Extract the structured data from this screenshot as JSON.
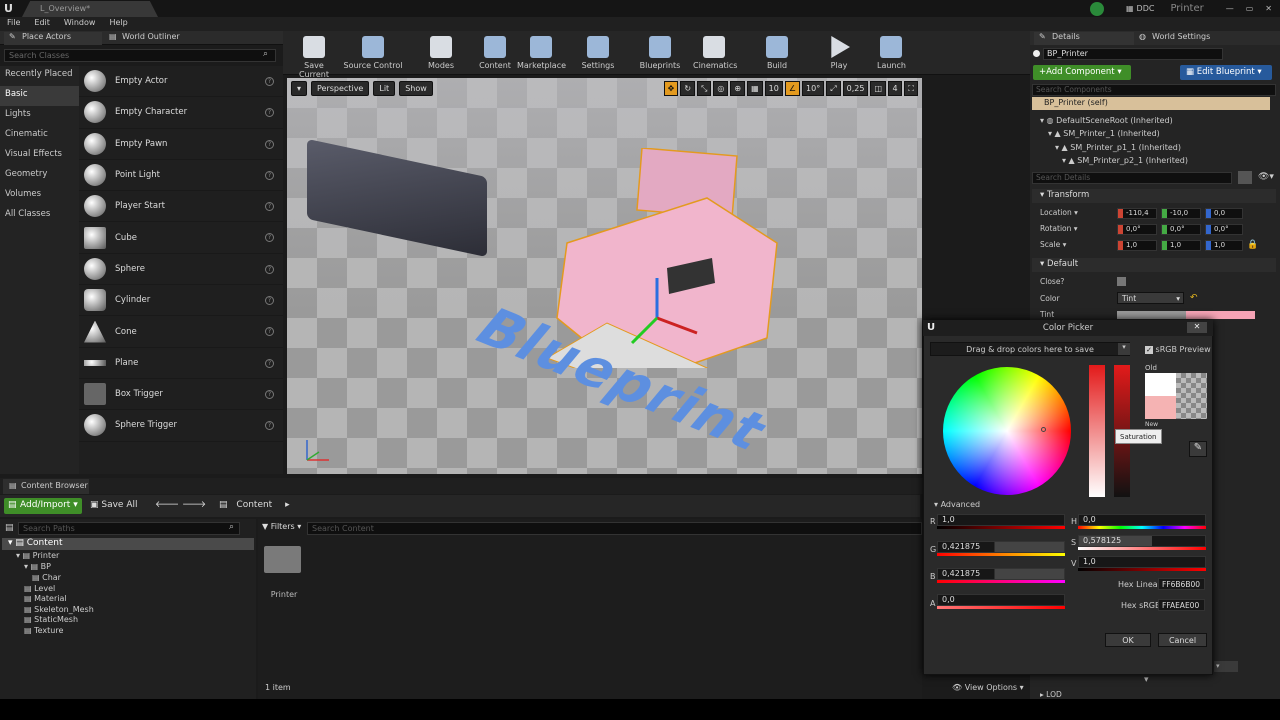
{
  "window": {
    "tab_title": "L_Overview*",
    "ddc": "DDC",
    "project": "Printer"
  },
  "menu": [
    "File",
    "Edit",
    "Window",
    "Help"
  ],
  "left_panel": {
    "tabs": {
      "place": "Place Actors",
      "outliner": "World Outliner"
    },
    "search_placeholder": "Search Classes",
    "categories": [
      "Recently Placed",
      "Basic",
      "Lights",
      "Cinematic",
      "Visual Effects",
      "Geometry",
      "Volumes",
      "All Classes"
    ],
    "actors": [
      "Empty Actor",
      "Empty Character",
      "Empty Pawn",
      "Point Light",
      "Player Start",
      "Cube",
      "Sphere",
      "Cylinder",
      "Cone",
      "Plane",
      "Box Trigger",
      "Sphere Trigger"
    ]
  },
  "toolbar": {
    "buttons": [
      "Save Current",
      "Source Control",
      "Modes",
      "Content",
      "Marketplace",
      "Settings",
      "Blueprints",
      "Cinematics",
      "Build",
      "Play",
      "Launch"
    ]
  },
  "viewport": {
    "perspective": "Perspective",
    "lit": "Lit",
    "show": "Show",
    "grid": "10",
    "angle": "10°",
    "scale": "0,25",
    "cam": "4",
    "overlay_text": "Blueprint"
  },
  "content_browser": {
    "tab": "Content Browser",
    "add_import": "Add/Import",
    "save_all": "Save All",
    "path": "Content",
    "path_search_placeholder": "Search Paths",
    "filters": "Filters",
    "search_placeholder": "Search Content",
    "tree": [
      "Content",
      "Printer",
      "BP",
      "Char",
      "Level",
      "Material",
      "Skeleton_Mesh",
      "StaticMesh",
      "Texture"
    ],
    "folder_label": "Printer",
    "item_count": "1 item",
    "view_options": "View Options"
  },
  "details": {
    "tabs": {
      "details": "Details",
      "world": "World Settings"
    },
    "bp_name": "BP_Printer",
    "add_component": "+Add Component",
    "edit_blueprint": "Edit Blueprint",
    "search_components_placeholder": "Search Components",
    "self": "BP_Printer (self)",
    "components": [
      "DefaultSceneRoot (Inherited)",
      "SM_Printer_1 (Inherited)",
      "SM_Printer_p1_1 (Inherited)",
      "SM_Printer_p2_1 (Inherited)"
    ],
    "search_details_placeholder": "Search Details",
    "transform": "Transform",
    "location_label": "Location",
    "location": [
      "-110,4",
      "-10,0",
      "0,0"
    ],
    "rotation_label": "Rotation",
    "rotation": [
      "0,0°",
      "0,0°",
      "0,0°"
    ],
    "scale_label": "Scale",
    "scale": [
      "1,0",
      "1,0",
      "1,0"
    ],
    "default": "Default",
    "close_label": "Close?",
    "color_label": "Color",
    "color_value": "Tint",
    "tint_label": "Tint",
    "lod": "LOD"
  },
  "color_picker": {
    "title": "Color Picker",
    "drag_hint": "Drag & drop colors here to save",
    "srgb": "sRGB Preview",
    "old": "Old",
    "new": "New",
    "tooltip": "Saturation",
    "advanced": "Advanced",
    "r": "1,0",
    "g": "0,421875",
    "b": "0,421875",
    "a": "0,0",
    "h": "0,0",
    "s": "0,578125",
    "v": "1,0",
    "hex_linear_label": "Hex Linear",
    "hex_linear": "FF6B6B00",
    "hex_srgb_label": "Hex sRGB",
    "hex_srgb": "FFAEAE00",
    "ok": "OK",
    "cancel": "Cancel"
  },
  "colors": {
    "green": "#3f8e28",
    "blue": "#275a9c",
    "tint": "#f5b3b3"
  }
}
